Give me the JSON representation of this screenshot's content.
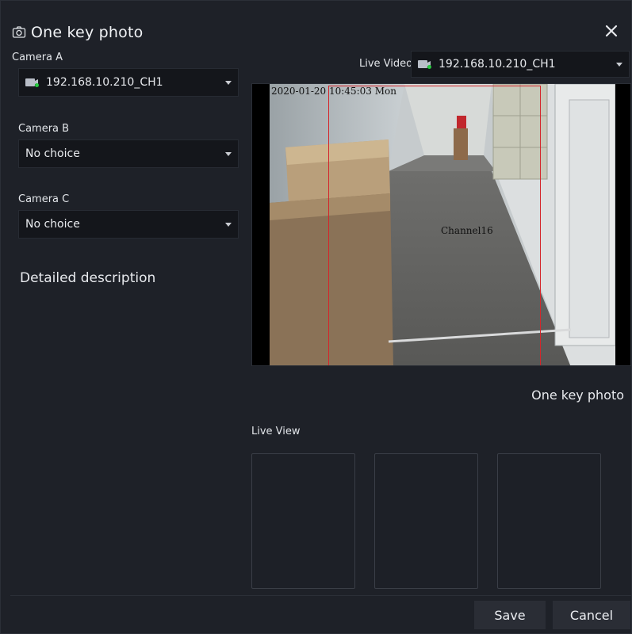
{
  "dialog": {
    "title": "One key photo",
    "title_icon": "camera-icon",
    "close_icon": "close-icon"
  },
  "camera_a": {
    "label": "Camera A",
    "value": "192.168.10.210_CH1",
    "icon": "camera-icon",
    "status_color": "#27c93f"
  },
  "camera_b": {
    "label": "Camera B",
    "value": "No choice"
  },
  "camera_c": {
    "label": "Camera C",
    "value": "No choice"
  },
  "description": {
    "label": "Detailed description"
  },
  "live_video": {
    "label": "Live Video",
    "value": "192.168.10.210_CH1",
    "osd_timestamp": "2020-01-20 10:45:03 Mon",
    "osd_channel": "Channel16",
    "roi_color": "#d4262b"
  },
  "one_key_photo_button": "One key photo",
  "live_view": {
    "label": "Live View"
  },
  "footer": {
    "save": "Save",
    "cancel": "Cancel"
  },
  "colors": {
    "background": "#1e2128",
    "field": "#14161b",
    "button": "#2a2d35",
    "accent_green": "#27c93f"
  }
}
